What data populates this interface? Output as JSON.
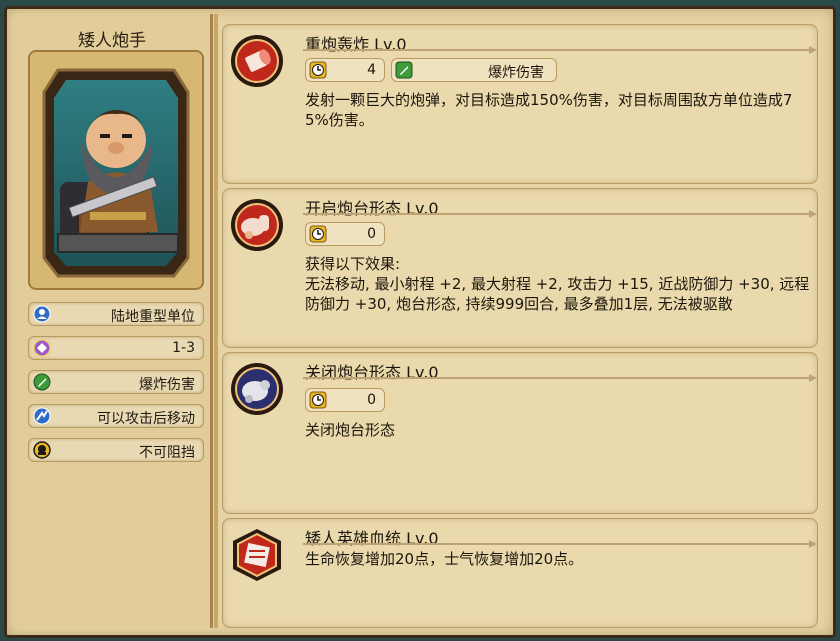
{
  "unit": {
    "name": "矮人炮手",
    "tags": [
      {
        "icon": "person-icon",
        "label": "陆地重型单位"
      },
      {
        "icon": "range-diamond-icon",
        "label": "1-3"
      },
      {
        "icon": "sword-icon",
        "label": "爆炸伤害"
      },
      {
        "icon": "move-after-attack-icon",
        "label": "可以攻击后移动"
      },
      {
        "icon": "unstoppable-icon",
        "label": "不可阻挡"
      }
    ]
  },
  "skills": [
    {
      "icon": "cannon-shell-icon",
      "title": "重炮轰炸 Lv.0",
      "cooldown": "4",
      "damage_type": "爆炸伤害",
      "description": "发射一颗巨大的炮弹，对目标造成150%伤害，对目标周围敌方单位造成75%伤害。"
    },
    {
      "icon": "fist-open-icon",
      "title": "开启炮台形态 Lv.0",
      "cooldown": "0",
      "description": "获得以下效果:\n无法移动, 最小射程 +2, 最大射程 +2, 攻击力 +15, 近战防御力 +30, 远程防御力 +30, 炮台形态, 持续999回合, 最多叠加1层, 无法被驱散"
    },
    {
      "icon": "fist-closed-icon",
      "title": "关闭炮台形态 Lv.0",
      "cooldown": "0",
      "description": "关闭炮台形态"
    },
    {
      "icon": "bloodline-emblem-icon",
      "title": "矮人英雄血统 Lv.0",
      "description": "生命恢复增加20点，士气恢复增加20点。"
    }
  ],
  "colors": {
    "parchment": "#e6d3a4",
    "border": "#3b2a18",
    "skill_red": "#c0281c",
    "clock_gold": "#e9b626",
    "sword_green": "#3e9b3a",
    "tag_blue": "#2d6cc7",
    "tag_purple": "#9b59c6"
  }
}
